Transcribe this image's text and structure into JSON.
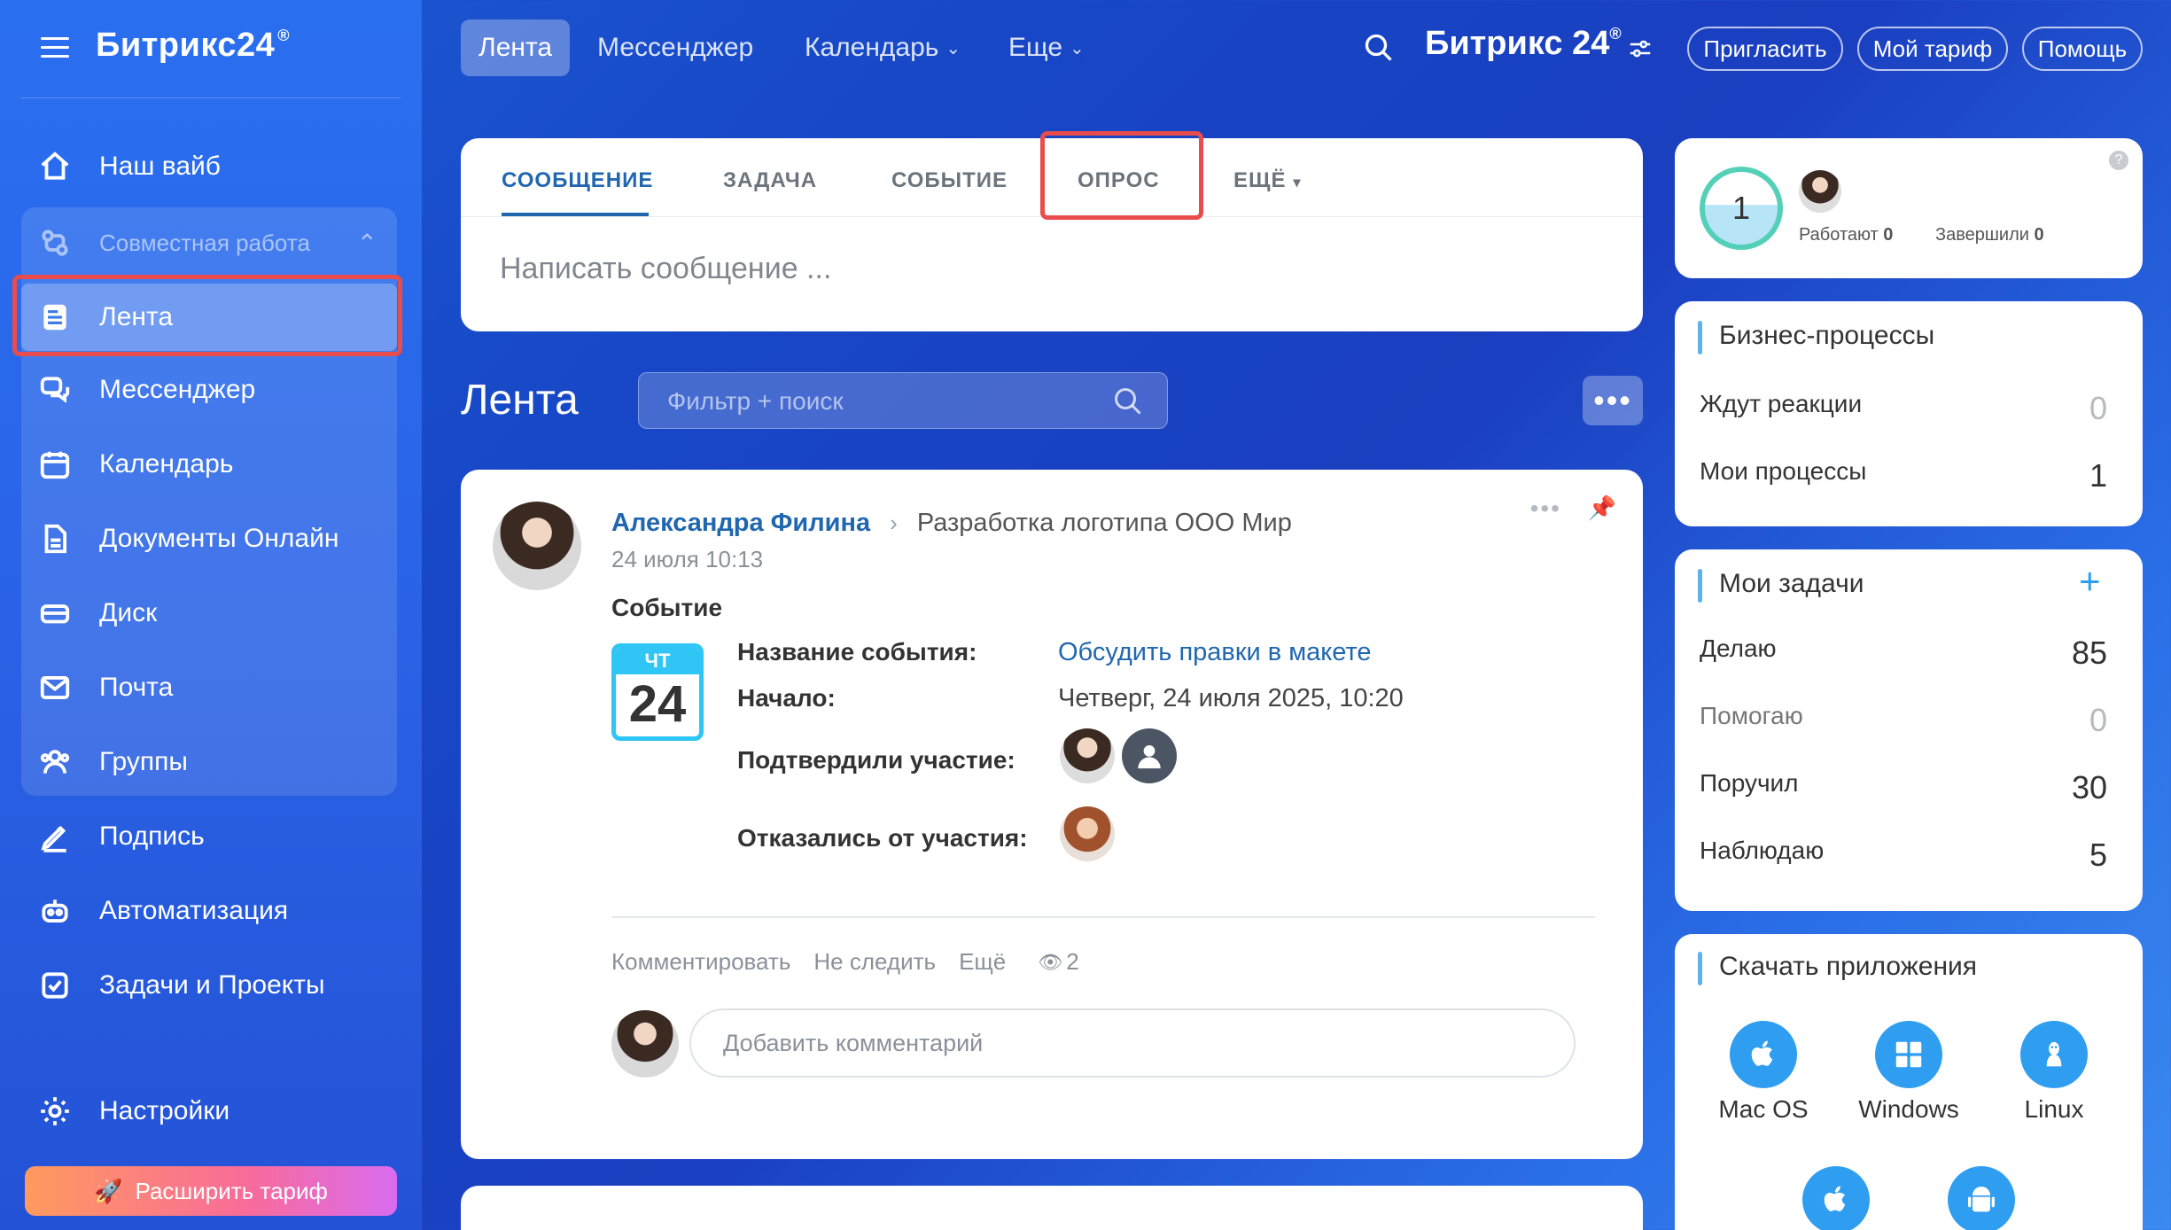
{
  "app": {
    "logo": "Битрикс24",
    "logo_mark": "®"
  },
  "sidebar": {
    "items": [
      {
        "label": "Наш вайб",
        "icon": "home-icon"
      },
      {
        "label": "Совместная работа",
        "icon": "collab-icon"
      },
      {
        "label": "Лента",
        "icon": "feed-icon"
      },
      {
        "label": "Мессенджер",
        "icon": "chat-icon"
      },
      {
        "label": "Календарь",
        "icon": "calendar-icon"
      },
      {
        "label": "Документы Онлайн",
        "icon": "document-icon"
      },
      {
        "label": "Диск",
        "icon": "disk-icon"
      },
      {
        "label": "Почта",
        "icon": "mail-icon"
      },
      {
        "label": "Группы",
        "icon": "groups-icon"
      },
      {
        "label": "Подпись",
        "icon": "sign-icon"
      },
      {
        "label": "Автоматизация",
        "icon": "robot-icon"
      },
      {
        "label": "Задачи и Проекты",
        "icon": "task-icon"
      },
      {
        "label": "Настройки",
        "icon": "gear-icon"
      }
    ],
    "upgrade_label": "Расширить тариф"
  },
  "header": {
    "tabs": [
      "Лента",
      "Мессенджер",
      "Календарь",
      "Еще"
    ],
    "brand": "Битрикс 24",
    "invite": "Пригласить",
    "tariff": "Мой тариф",
    "help": "Помощь"
  },
  "composer": {
    "tabs": [
      "СООБЩЕНИЕ",
      "ЗАДАЧА",
      "СОБЫТИЕ",
      "ОПРОС",
      "ЕЩЁ"
    ],
    "placeholder": "Написать сообщение ..."
  },
  "feed": {
    "title": "Лента",
    "filter_placeholder": "Фильтр + поиск"
  },
  "post": {
    "author": "Александра Филина",
    "destination": "Разработка логотипа ООО Мир",
    "date": "24 июля 10:13",
    "type": "Событие",
    "cal_day_name": "ЧТ",
    "cal_day": "24",
    "event_name_label": "Название события:",
    "event_name": "Обсудить правки в макете",
    "start_label": "Начало:",
    "start": "Четверг, 24 июля 2025, 10:20",
    "confirmed_label": "Подтвердили участие:",
    "declined_label": "Отказались от участия:",
    "actions": [
      "Комментировать",
      "Не следить",
      "Ещё"
    ],
    "views": "2",
    "comment_placeholder": "Добавить комментарий"
  },
  "worktime": {
    "count": "1",
    "working_label": "Работают",
    "working": "0",
    "done_label": "Завершили",
    "done": "0"
  },
  "bp": {
    "title": "Бизнес-процессы",
    "rows": [
      {
        "label": "Ждут реакции",
        "value": "0"
      },
      {
        "label": "Мои процессы",
        "value": "1"
      }
    ]
  },
  "tasks": {
    "title": "Мои задачи",
    "rows": [
      {
        "label": "Делаю",
        "value": "85"
      },
      {
        "label": "Помогаю",
        "value": "0"
      },
      {
        "label": "Поручил",
        "value": "30"
      },
      {
        "label": "Наблюдаю",
        "value": "5"
      }
    ]
  },
  "apps": {
    "title": "Скачать приложения",
    "items": [
      "Mac OS",
      "Windows",
      "Linux"
    ]
  }
}
